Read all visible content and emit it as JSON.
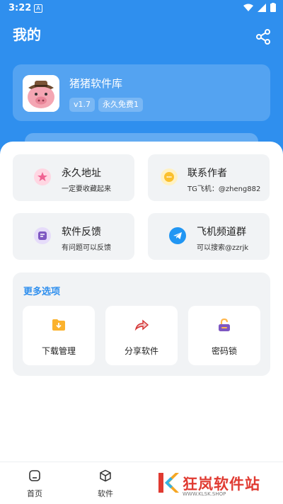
{
  "status": {
    "time": "3:22",
    "a_icon": "A"
  },
  "header": {
    "title": "我的"
  },
  "profile": {
    "name": "猪猪软件库",
    "version": "v1.7",
    "free_badge": "永久免费1"
  },
  "tiles": [
    {
      "title": "永久地址",
      "subtitle": "一定要收藏起来",
      "icon": "star-icon",
      "color": "#f06292"
    },
    {
      "title": "联系作者",
      "subtitle": "TG飞机：@zheng882",
      "icon": "chat-icon",
      "color": "#fbc02d"
    },
    {
      "title": "软件反馈",
      "subtitle": "有问题可以反馈",
      "icon": "feedback-icon",
      "color": "#7e57c2"
    },
    {
      "title": "飞机频道群",
      "subtitle": "可以搜索@zzrjk",
      "icon": "telegram-icon",
      "color": "#2196f3"
    }
  ],
  "more": {
    "title": "更多选项",
    "items": [
      {
        "label": "下载管理",
        "icon": "download-folder-icon",
        "color": "#fbb22d"
      },
      {
        "label": "分享软件",
        "icon": "share-arrow-icon",
        "color": "#e57373"
      },
      {
        "label": "密码锁",
        "icon": "lock-icon",
        "color": "#7e57c2"
      }
    ]
  },
  "nav": {
    "home": "首页",
    "software": "软件"
  },
  "watermark": {
    "text": "狂岚软件站",
    "sub": "WWW.KLSK.SHOP"
  },
  "colors": {
    "primary": "#2f8fee",
    "watermark": "#e03a31"
  }
}
